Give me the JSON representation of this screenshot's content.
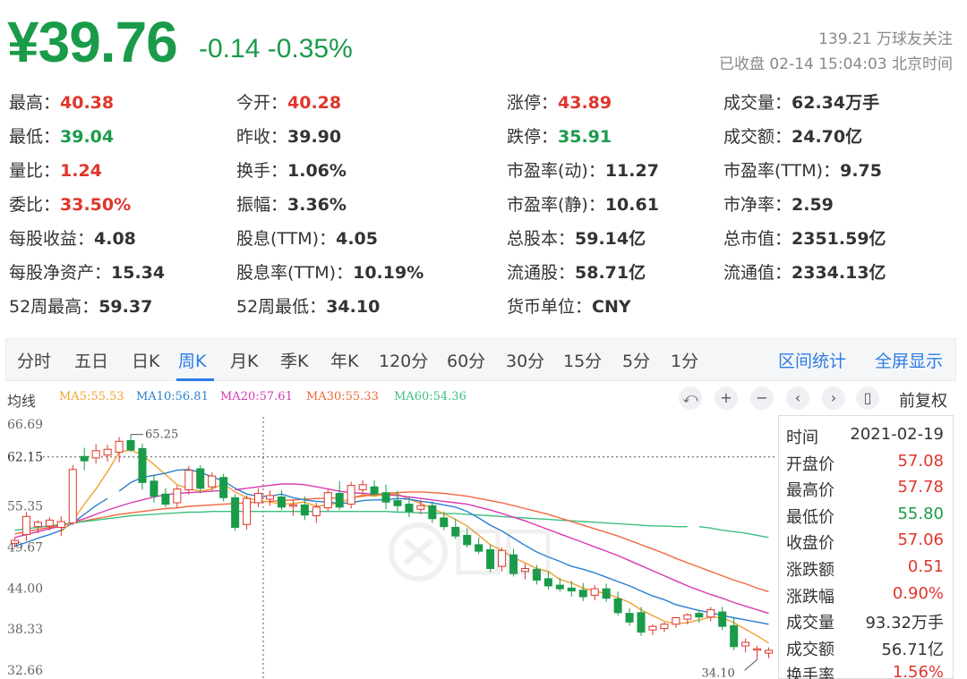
{
  "quote": {
    "price": "¥39.76",
    "change": "-0.14",
    "change_pct": "-0.35%",
    "followers": "139.21 万球友关注",
    "status_line": "已收盘 02-14 15:04:03 北京时间"
  },
  "stats": {
    "rows": [
      [
        {
          "label": "最高：",
          "value": "40.38",
          "tone": "up"
        },
        {
          "label": "今开：",
          "value": "40.28",
          "tone": "up"
        },
        {
          "label": "涨停：",
          "value": "43.89",
          "tone": "up"
        },
        {
          "label": "成交量：",
          "value": "62.34万手",
          "tone": ""
        }
      ],
      [
        {
          "label": "最低：",
          "value": "39.04",
          "tone": "down"
        },
        {
          "label": "昨收：",
          "value": "39.90",
          "tone": ""
        },
        {
          "label": "跌停：",
          "value": "35.91",
          "tone": "down"
        },
        {
          "label": "成交额：",
          "value": "24.70亿",
          "tone": ""
        }
      ],
      [
        {
          "label": "量比：",
          "value": "1.24",
          "tone": "up"
        },
        {
          "label": "换手：",
          "value": "1.06%",
          "tone": ""
        },
        {
          "label": "市盈率(动)：",
          "value": "11.27",
          "tone": ""
        },
        {
          "label": "市盈率(TTM)：",
          "value": "9.75",
          "tone": ""
        }
      ],
      [
        {
          "label": "委比：",
          "value": "33.50%",
          "tone": "up"
        },
        {
          "label": "振幅：",
          "value": "3.36%",
          "tone": ""
        },
        {
          "label": "市盈率(静)：",
          "value": "10.61",
          "tone": ""
        },
        {
          "label": "市净率：",
          "value": "2.59",
          "tone": ""
        }
      ],
      [
        {
          "label": "每股收益：",
          "value": "4.08",
          "tone": ""
        },
        {
          "label": "股息(TTM)：",
          "value": "4.05",
          "tone": ""
        },
        {
          "label": "总股本：",
          "value": "59.14亿",
          "tone": ""
        },
        {
          "label": "总市值：",
          "value": "2351.59亿",
          "tone": ""
        }
      ],
      [
        {
          "label": "每股净资产：",
          "value": "15.34",
          "tone": ""
        },
        {
          "label": "股息率(TTM)：",
          "value": "10.19%",
          "tone": ""
        },
        {
          "label": "流通股：",
          "value": "58.71亿",
          "tone": ""
        },
        {
          "label": "流通值：",
          "value": "2334.13亿",
          "tone": ""
        }
      ],
      [
        {
          "label": "52周最高：",
          "value": "59.37",
          "tone": ""
        },
        {
          "label": "52周最低：",
          "value": "34.10",
          "tone": ""
        },
        {
          "label": "货币单位：",
          "value": "CNY",
          "tone": ""
        }
      ]
    ]
  },
  "tabs": {
    "items": [
      "分时",
      "五日",
      "日K",
      "周K",
      "月K",
      "季K",
      "年K",
      "120分",
      "60分",
      "30分",
      "15分",
      "5分",
      "1分"
    ],
    "active": "周K",
    "range_stats": "区间统计",
    "fullscreen": "全屏显示"
  },
  "indicators": {
    "label": "均线",
    "ma": [
      {
        "text": "MA5:55.53",
        "color": "#f0a030"
      },
      {
        "text": "MA10:56.81",
        "color": "#2a7fd0"
      },
      {
        "text": "MA20:57.61",
        "color": "#d63ab5"
      },
      {
        "text": "MA30:55.33",
        "color": "#f0683c"
      },
      {
        "text": "MA60:54.36",
        "color": "#3cbf80"
      }
    ],
    "tools": [
      {
        "name": "undo-icon",
        "glyph": "⤺"
      },
      {
        "name": "zoom-in-icon",
        "glyph": "+"
      },
      {
        "name": "zoom-out-icon",
        "glyph": "−"
      },
      {
        "name": "chevron-left-icon",
        "glyph": "‹"
      },
      {
        "name": "chevron-right-icon",
        "glyph": "›"
      },
      {
        "name": "candle-icon",
        "glyph": "▯"
      }
    ],
    "adjust": "前复权"
  },
  "tooltip": {
    "rows": [
      {
        "k": "时间",
        "v": "2021-02-19",
        "tone": ""
      },
      {
        "k": "开盘价",
        "v": "57.08",
        "tone": "up"
      },
      {
        "k": "最高价",
        "v": "57.78",
        "tone": "up"
      },
      {
        "k": "最低价",
        "v": "55.80",
        "tone": "down"
      },
      {
        "k": "收盘价",
        "v": "57.06",
        "tone": "up"
      },
      {
        "k": "涨跌额",
        "v": "0.51",
        "tone": "up"
      },
      {
        "k": "涨跌幅",
        "v": "0.90%",
        "tone": "up"
      },
      {
        "k": "成交量",
        "v": "93.32万手",
        "tone": ""
      },
      {
        "k": "成交额",
        "v": "56.71亿",
        "tone": ""
      },
      {
        "k": "换手率",
        "v": "1.56%",
        "tone": "up"
      }
    ]
  },
  "chart_data": {
    "type": "candlestick",
    "y_ticks": [
      "66.69",
      "62.15",
      "55.35",
      "49.67",
      "44.00",
      "38.33",
      "32.66"
    ],
    "ylim": [
      32.66,
      66.69
    ],
    "crosshair_price": "62.15",
    "high_label": "65.25",
    "low_label": "34.10",
    "candles": [
      {
        "o": 50.2,
        "h": 51.0,
        "l": 49.6,
        "c": 50.6
      },
      {
        "o": 51.4,
        "h": 54.5,
        "l": 50.5,
        "c": 53.9
      },
      {
        "o": 52.5,
        "h": 53.4,
        "l": 51.6,
        "c": 53.1
      },
      {
        "o": 52.6,
        "h": 53.8,
        "l": 52.0,
        "c": 53.4
      },
      {
        "o": 52.4,
        "h": 53.9,
        "l": 51.2,
        "c": 53.2
      },
      {
        "o": 53.0,
        "h": 61.0,
        "l": 52.7,
        "c": 60.4
      },
      {
        "o": 62.2,
        "h": 63.4,
        "l": 60.3,
        "c": 61.6
      },
      {
        "o": 62.0,
        "h": 63.9,
        "l": 61.2,
        "c": 63.0
      },
      {
        "o": 62.4,
        "h": 63.8,
        "l": 61.5,
        "c": 63.2
      },
      {
        "o": 62.8,
        "h": 64.9,
        "l": 61.4,
        "c": 64.3
      },
      {
        "o": 64.4,
        "h": 65.25,
        "l": 62.8,
        "c": 63.1
      },
      {
        "o": 63.3,
        "h": 64.0,
        "l": 57.6,
        "c": 58.6
      },
      {
        "o": 58.8,
        "h": 59.7,
        "l": 55.8,
        "c": 56.7
      },
      {
        "o": 57.0,
        "h": 57.8,
        "l": 55.2,
        "c": 55.6
      },
      {
        "o": 55.8,
        "h": 58.2,
        "l": 55.0,
        "c": 57.7
      },
      {
        "o": 57.6,
        "h": 60.9,
        "l": 56.9,
        "c": 60.3
      },
      {
        "o": 60.5,
        "h": 61.0,
        "l": 57.1,
        "c": 57.8
      },
      {
        "o": 58.0,
        "h": 60.0,
        "l": 57.4,
        "c": 59.5
      },
      {
        "o": 59.3,
        "h": 59.8,
        "l": 56.0,
        "c": 56.5
      },
      {
        "o": 56.5,
        "h": 57.0,
        "l": 51.9,
        "c": 52.4
      },
      {
        "o": 52.8,
        "h": 56.8,
        "l": 52.1,
        "c": 56.4
      },
      {
        "o": 55.8,
        "h": 57.8,
        "l": 55.2,
        "c": 57.1
      },
      {
        "o": 56.3,
        "h": 57.5,
        "l": 55.4,
        "c": 56.8
      },
      {
        "o": 56.6,
        "h": 57.5,
        "l": 54.8,
        "c": 55.2
      },
      {
        "o": 55.4,
        "h": 56.2,
        "l": 54.0,
        "c": 55.5
      },
      {
        "o": 55.5,
        "h": 56.7,
        "l": 53.4,
        "c": 54.1
      },
      {
        "o": 54.0,
        "h": 55.8,
        "l": 53.0,
        "c": 55.2
      },
      {
        "o": 55.1,
        "h": 57.6,
        "l": 54.6,
        "c": 57.2
      },
      {
        "o": 57.1,
        "h": 58.8,
        "l": 54.8,
        "c": 55.2
      },
      {
        "o": 55.6,
        "h": 58.7,
        "l": 55.0,
        "c": 58.2
      },
      {
        "o": 57.6,
        "h": 58.9,
        "l": 57.0,
        "c": 58.3
      },
      {
        "o": 58.0,
        "h": 58.9,
        "l": 56.8,
        "c": 57.0
      },
      {
        "o": 57.2,
        "h": 58.3,
        "l": 54.9,
        "c": 55.9
      },
      {
        "o": 56.1,
        "h": 57.5,
        "l": 54.6,
        "c": 55.4
      },
      {
        "o": 55.6,
        "h": 56.6,
        "l": 53.8,
        "c": 54.6
      },
      {
        "o": 54.9,
        "h": 56.2,
        "l": 54.2,
        "c": 55.4
      },
      {
        "o": 55.4,
        "h": 56.0,
        "l": 53.0,
        "c": 53.6
      },
      {
        "o": 53.7,
        "h": 54.6,
        "l": 52.0,
        "c": 52.5
      },
      {
        "o": 52.4,
        "h": 53.6,
        "l": 50.8,
        "c": 51.2
      },
      {
        "o": 51.3,
        "h": 52.3,
        "l": 49.6,
        "c": 50.0
      },
      {
        "o": 50.0,
        "h": 51.0,
        "l": 48.7,
        "c": 49.1
      },
      {
        "o": 49.3,
        "h": 50.0,
        "l": 46.2,
        "c": 46.7
      },
      {
        "o": 47.0,
        "h": 49.6,
        "l": 46.3,
        "c": 49.2
      },
      {
        "o": 48.6,
        "h": 49.4,
        "l": 45.6,
        "c": 46.0
      },
      {
        "o": 46.3,
        "h": 47.4,
        "l": 45.2,
        "c": 46.7
      },
      {
        "o": 46.6,
        "h": 47.2,
        "l": 44.5,
        "c": 45.1
      },
      {
        "o": 45.3,
        "h": 46.3,
        "l": 43.8,
        "c": 44.3
      },
      {
        "o": 44.4,
        "h": 45.4,
        "l": 43.5,
        "c": 43.9
      },
      {
        "o": 44.0,
        "h": 45.0,
        "l": 42.8,
        "c": 43.6
      },
      {
        "o": 43.7,
        "h": 44.7,
        "l": 42.2,
        "c": 42.8
      },
      {
        "o": 43.0,
        "h": 44.4,
        "l": 42.3,
        "c": 43.9
      },
      {
        "o": 43.9,
        "h": 44.6,
        "l": 42.1,
        "c": 42.6
      },
      {
        "o": 42.5,
        "h": 43.5,
        "l": 40.2,
        "c": 40.6
      },
      {
        "o": 40.5,
        "h": 41.2,
        "l": 38.8,
        "c": 39.3
      },
      {
        "o": 40.6,
        "h": 41.4,
        "l": 37.4,
        "c": 37.9
      },
      {
        "o": 38.2,
        "h": 39.0,
        "l": 37.5,
        "c": 38.7
      },
      {
        "o": 38.4,
        "h": 39.3,
        "l": 37.9,
        "c": 39.0
      },
      {
        "o": 39.0,
        "h": 40.0,
        "l": 38.5,
        "c": 39.9
      },
      {
        "o": 39.7,
        "h": 40.5,
        "l": 39.0,
        "c": 40.3
      },
      {
        "o": 40.5,
        "h": 41.0,
        "l": 39.2,
        "c": 40.0
      },
      {
        "o": 40.0,
        "h": 41.4,
        "l": 39.4,
        "c": 41.0
      },
      {
        "o": 40.7,
        "h": 41.4,
        "l": 38.2,
        "c": 38.7
      },
      {
        "o": 38.8,
        "h": 39.9,
        "l": 35.4,
        "c": 35.9
      },
      {
        "o": 36.0,
        "h": 37.0,
        "l": 35.1,
        "c": 36.5
      },
      {
        "o": 35.5,
        "h": 36.0,
        "l": 34.1,
        "c": 35.6
      },
      {
        "o": 35.0,
        "h": 35.8,
        "l": 34.3,
        "c": 35.4
      }
    ],
    "ma_lines": [
      {
        "name": "MA5",
        "color": "#f0a030",
        "values": [
          null,
          null,
          null,
          null,
          51.8,
          53.3,
          55.6,
          57.7,
          60.1,
          62.8,
          63.1,
          62.4,
          61.1,
          59.7,
          58.3,
          57.7,
          57.4,
          57.7,
          58.4,
          57.3,
          56.5,
          56.1,
          55.9,
          55.6,
          55.7,
          55.9,
          55.3,
          55.5,
          55.8,
          56.4,
          56.9,
          56.7,
          57.0,
          57.0,
          56.3,
          55.7,
          55.0,
          54.3,
          53.5,
          52.6,
          51.3,
          50.0,
          49.2,
          48.2,
          47.5,
          46.7,
          46.3,
          45.2,
          44.7,
          44.0,
          43.6,
          43.2,
          42.7,
          42.0,
          41.0,
          40.2,
          39.4,
          39.1,
          39.2,
          39.6,
          40.0,
          39.9,
          39.2,
          38.3,
          37.4,
          36.4
        ]
      },
      {
        "name": "MA10",
        "color": "#2a7fd0",
        "values": [
          null,
          null,
          null,
          null,
          null,
          null,
          null,
          null,
          null,
          57.4,
          58.6,
          59.3,
          59.6,
          59.9,
          60.3,
          60.4,
          60.0,
          59.4,
          58.8,
          57.8,
          57.0,
          56.7,
          56.7,
          57.0,
          56.5,
          56.2,
          56.0,
          55.9,
          55.7,
          55.8,
          56.1,
          56.2,
          56.2,
          56.4,
          56.3,
          56.0,
          55.8,
          55.5,
          55.2,
          54.6,
          53.7,
          52.7,
          51.9,
          50.9,
          49.9,
          49.0,
          48.3,
          47.7,
          47.0,
          46.6,
          46.1,
          45.5,
          44.9,
          44.3,
          43.6,
          42.9,
          42.4,
          41.7,
          41.3,
          40.9,
          40.6,
          40.2,
          39.9,
          39.6,
          39.3,
          39.0
        ]
      },
      {
        "name": "MA20",
        "color": "#d63ab5",
        "values": [
          null,
          null,
          null,
          null,
          null,
          null,
          null,
          null,
          null,
          null,
          null,
          null,
          null,
          null,
          null,
          null,
          null,
          null,
          null,
          57.6,
          57.8,
          58.0,
          58.2,
          58.4,
          58.4,
          58.3,
          58.0,
          57.7,
          57.4,
          57.2,
          57.1,
          57.0,
          56.9,
          56.8,
          56.6,
          56.4,
          56.2,
          56.0,
          55.8,
          55.6,
          55.2,
          54.8,
          54.3,
          53.8,
          53.3,
          52.7,
          52.1,
          51.5,
          50.9,
          50.3,
          49.7,
          49.1,
          48.5,
          47.8,
          47.1,
          46.4,
          45.7,
          45.0,
          44.3,
          43.7,
          43.1,
          42.6,
          42.0,
          41.5,
          41.0,
          40.5
        ]
      },
      {
        "name": "MA30",
        "color": "#f0683c",
        "values": [
          null,
          null,
          null,
          null,
          null,
          null,
          null,
          null,
          null,
          null,
          null,
          null,
          null,
          null,
          null,
          null,
          null,
          null,
          null,
          null,
          null,
          null,
          null,
          null,
          null,
          null,
          null,
          null,
          null,
          56.5,
          56.7,
          56.9,
          57.1,
          57.2,
          57.3,
          57.3,
          57.2,
          57.1,
          56.9,
          56.7,
          56.4,
          56.1,
          55.8,
          55.4,
          55.0,
          54.6,
          54.2,
          53.7,
          53.2,
          52.7,
          52.2,
          51.7,
          51.2,
          50.6,
          50.0,
          49.4,
          48.8,
          48.1,
          47.5,
          46.9,
          46.3,
          45.7,
          45.1,
          44.6,
          44.0,
          43.5
        ]
      },
      {
        "name": "MA60",
        "color": "#3cbf80",
        "values": [
          null,
          null,
          null,
          null,
          null,
          null,
          null,
          null,
          null,
          null,
          null,
          null,
          null,
          null,
          null,
          null,
          null,
          null,
          null,
          null,
          null,
          null,
          null,
          null,
          null,
          null,
          null,
          null,
          null,
          null,
          null,
          null,
          null,
          null,
          null,
          null,
          null,
          null,
          null,
          null,
          null,
          null,
          null,
          null,
          null,
          null,
          null,
          null,
          null,
          null,
          null,
          null,
          null,
          null,
          null,
          null,
          null,
          null,
          null,
          52.5,
          52.3,
          52.0,
          51.8,
          51.6,
          51.3,
          51.0
        ]
      }
    ],
    "early_ma": [
      {
        "name": "MA10",
        "values": [
          49.8,
          50.3,
          50.9,
          51.4,
          52.0,
          53.0,
          54.2,
          55.4,
          56.4
        ]
      },
      {
        "name": "MA20",
        "values": [
          51.0,
          51.4,
          51.8,
          52.2,
          52.6,
          53.1,
          53.6,
          54.2,
          54.8,
          55.3,
          55.8,
          56.2,
          56.6,
          56.9,
          57.1,
          57.2,
          57.3,
          57.4,
          57.5
        ]
      },
      {
        "name": "MA30",
        "values": [
          51.5,
          51.8,
          52.1,
          52.4,
          52.7,
          53.0,
          53.3,
          53.6,
          53.9,
          54.2,
          54.4,
          54.6,
          54.8,
          55.0,
          55.1,
          55.3,
          55.4,
          55.5,
          55.6,
          55.7,
          55.8,
          55.9,
          56.0,
          56.1,
          56.2,
          56.3,
          56.4,
          56.4,
          56.5
        ]
      },
      {
        "name": "MA60",
        "values": [
          52.0,
          52.2,
          52.4,
          52.6,
          52.8,
          53.0,
          53.2,
          53.4,
          53.6,
          53.8,
          54.0,
          54.1,
          54.2,
          54.3,
          54.4,
          54.5,
          54.5,
          54.6,
          54.6,
          54.6,
          54.6,
          54.6,
          54.6,
          54.6,
          54.6,
          54.6,
          54.6,
          54.6,
          54.6,
          54.6,
          54.6,
          54.6,
          54.6,
          54.5,
          54.5,
          54.4,
          54.4,
          54.3,
          54.3,
          54.2,
          54.1,
          54.0,
          53.9,
          53.8,
          53.7,
          53.6,
          53.5,
          53.4,
          53.3,
          53.2,
          53.1,
          53.0,
          52.9,
          52.8,
          52.7,
          52.6,
          52.6,
          52.5,
          52.5
        ]
      }
    ]
  }
}
